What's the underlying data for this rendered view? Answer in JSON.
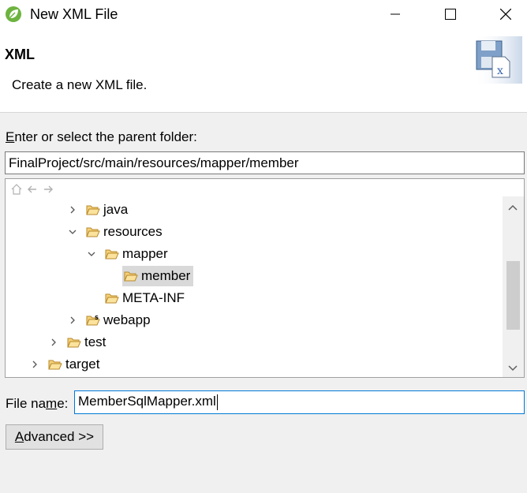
{
  "window": {
    "title": "New XML File",
    "icon": "spring-leaf-icon"
  },
  "header": {
    "title": "XML",
    "description": "Create a new XML file.",
    "image": "xml-file-banner-icon"
  },
  "folder": {
    "label_prefix": "E",
    "label_rest": "nter or select the parent folder:",
    "path": "FinalProject/src/main/resources/mapper/member"
  },
  "tree": {
    "items": [
      {
        "label": "java",
        "state": "collapsed",
        "depth": 3
      },
      {
        "label": "resources",
        "state": "expanded",
        "depth": 3
      },
      {
        "label": "mapper",
        "state": "expanded",
        "depth": 4
      },
      {
        "label": "member",
        "state": "leaf",
        "depth": 5,
        "selected": true
      },
      {
        "label": "META-INF",
        "state": "leaf",
        "depth": 4
      },
      {
        "label": "webapp",
        "state": "collapsed",
        "depth": 3,
        "badge": "S"
      },
      {
        "label": "test",
        "state": "collapsed",
        "depth": 2
      },
      {
        "label": "target",
        "state": "collapsed",
        "depth": 1
      }
    ]
  },
  "file_name": {
    "label_a": "File na",
    "label_u": "m",
    "label_b": "e:",
    "value": "MemberSqlMapper.xml"
  },
  "advanced": {
    "label_u": "A",
    "label_rest": "dvanced >>"
  }
}
